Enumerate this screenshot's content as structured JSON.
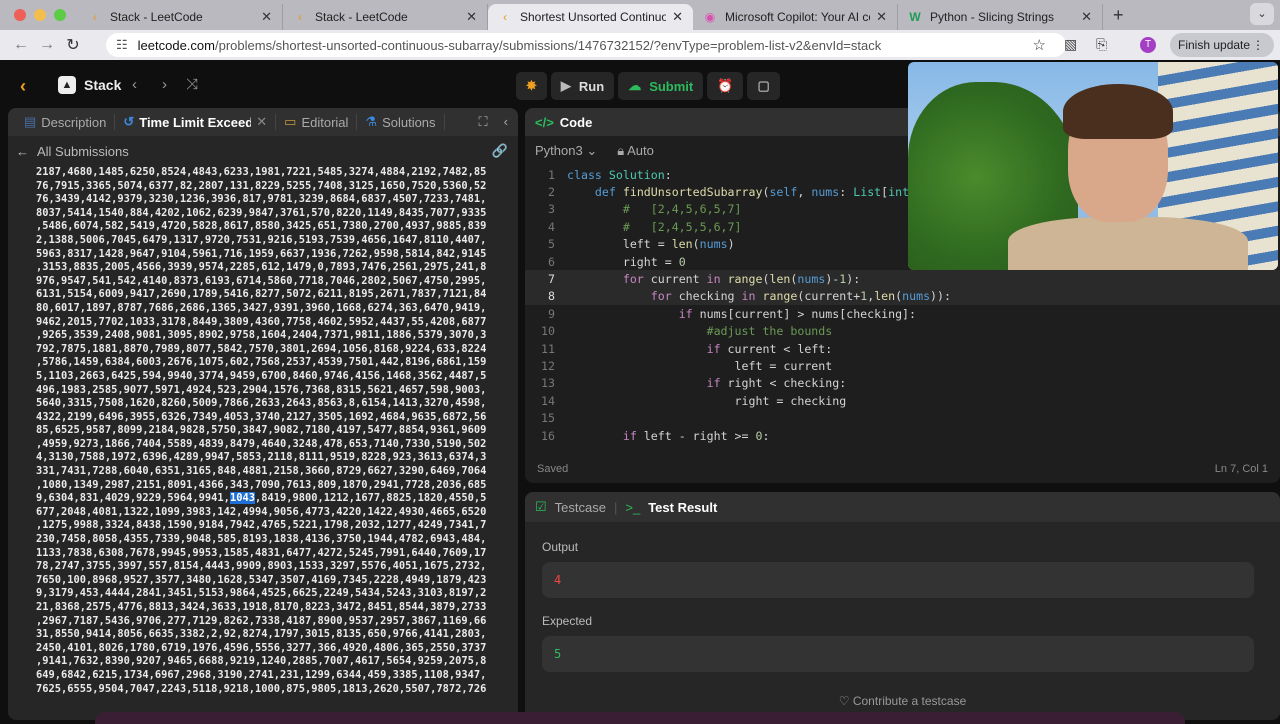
{
  "browser": {
    "tabs": [
      {
        "title": "Stack - LeetCode",
        "icon": "leetcode-icon",
        "active": false
      },
      {
        "title": "Stack - LeetCode",
        "icon": "leetcode-icon",
        "active": false
      },
      {
        "title": "Shortest Unsorted Continuous",
        "icon": "leetcode-icon",
        "active": true
      },
      {
        "title": "Microsoft Copilot: Your AI com",
        "icon": "copilot-icon",
        "active": false
      },
      {
        "title": "Python - Slicing Strings",
        "icon": "w3schools-icon",
        "active": false
      }
    ],
    "url_host": "leetcode.com",
    "url_path": "/problems/shortest-unsorted-continuous-subarray/submissions/1476732152/?envType=problem-list-v2&envId=stack",
    "profile_initial": "T",
    "finish_update": "Finish update"
  },
  "lc_nav": {
    "problem_list": "Stack",
    "run": "Run",
    "submit": "Submit"
  },
  "left_panel": {
    "tabs": [
      "Description",
      "Time Limit Exceeded",
      "Editorial",
      "Solutions"
    ],
    "back_label": "All Submissions",
    "numbers_before": "2187,4680,1485,6250,8524,4843,6233,1981,7221,5485,3274,4884,2192,7482,85\n76,7915,3365,5074,6377,82,2807,131,8229,5255,7408,3125,1650,7520,5360,52\n76,3439,4142,9379,3230,1236,3936,817,9781,3239,8684,6837,4507,7233,7481,\n8037,5414,1540,884,4202,1062,6239,9847,3761,570,8220,1149,8435,7077,9335\n,5486,6074,582,5419,4720,5828,8617,8580,3425,651,7380,2700,4937,9885,839\n2,1388,5006,7045,6479,1317,9720,7531,9216,5193,7539,4656,1647,8110,4407,\n5963,8317,1428,9647,9104,5961,716,1959,6637,1936,7262,9598,5814,842,9145\n,3153,8835,2005,4566,3939,9574,2285,612,1479,0,7893,7476,2561,2975,241,8\n976,9547,541,542,4140,8373,6193,6714,5860,7718,7046,2802,5067,4750,2995,\n6131,5154,6009,9417,2690,1789,5416,8277,5072,6211,8195,2671,7837,7121,84\n80,6017,1897,8787,7686,2686,1365,3427,9391,3960,1668,6274,363,6470,9419,\n9462,2015,7702,1033,3178,8449,3809,4360,7758,4602,5952,4437,55,4208,6877\n,9265,3539,2408,9081,3095,8902,9758,1604,2404,7371,9811,1886,5379,3070,3\n792,7875,1881,8870,7989,8077,5842,7570,3801,2694,1056,8168,9224,633,8224\n,5786,1459,6384,6003,2676,1075,602,7568,2537,4539,7501,442,8196,6861,159\n5,1103,2663,6425,594,9940,3774,9459,6700,8460,9746,4156,1468,3562,4487,5\n496,1983,2585,9077,5971,4924,523,2904,1576,7368,8315,5621,4657,598,9003,\n5640,3315,7508,1620,8260,5009,7866,2633,2643,8563,8,6154,1413,3270,4598,\n4322,2199,6496,3955,6326,7349,4053,3740,2127,3505,1692,4684,9635,6872,56\n85,6525,9587,8099,2184,9828,5750,3847,9082,7180,4197,5477,8854,9361,9609\n,4959,9273,1866,7404,5589,4839,8479,4640,3248,478,653,7140,7330,5190,502\n4,3130,7588,1972,6396,4289,9947,5853,2118,8111,9519,8228,923,3613,6374,3\n331,7431,7288,6040,6351,3165,848,4881,2158,3660,8729,6627,3290,6469,7064\n,1080,1349,2987,2151,8091,4366,343,7090,7613,809,1870,2941,7728,2036,685\n9,6304,831,4029,9229,5964,9941,",
    "numbers_selected": "1043",
    "numbers_after": ",8419,9800,1212,1677,8825,1820,4550,5\n677,2048,4081,1322,1099,3983,142,4994,9056,4773,4220,1422,4930,4665,6520\n,1275,9988,3324,8438,1590,9184,7942,4765,5221,1798,2032,1277,4249,7341,7\n230,7458,8058,4355,7339,9048,585,8193,1838,4136,3750,1944,4782,6943,484,\n1133,7838,6308,7678,9945,9953,1585,4831,6477,4272,5245,7991,6440,7609,17\n78,2747,3755,3997,557,8154,4443,9909,8903,1533,3297,5576,4051,1675,2732,\n7650,100,8968,9527,3577,3480,1628,5347,3507,4169,7345,2228,4949,1879,423\n9,3179,453,4444,2841,3451,5153,9864,4525,6625,2249,5434,5243,3103,8197,2\n21,8368,2575,4776,8813,3424,3633,1918,8170,8223,3472,8451,8544,3879,2733\n,2967,7187,5436,9706,277,7129,8262,7338,4187,8900,9537,2957,3867,1169,66\n31,8550,9414,8056,6635,3382,2,92,8274,1797,3015,8135,650,9766,4141,2803,\n2450,4101,8026,1780,6719,1976,4596,5556,3277,366,4920,4806,365,2550,3737\n,9141,7632,8390,9207,9465,6688,9219,1240,2885,7007,4617,5654,9259,2075,8\n649,6842,6215,1734,6967,2968,3190,2741,231,1299,6344,459,3385,1108,9347,\n7625,6555,9504,7047,2243,5118,9218,1000,875,9805,1813,2620,5507,7872,726"
  },
  "editor": {
    "title": "Code",
    "language": "Python3",
    "mode": "Auto",
    "status": "Saved",
    "cursor": "Ln 7, Col 1",
    "lines": [
      "class Solution:",
      "    def findUnsortedSubarray(self, nums: List[int]) -> int:",
      "        #   [2,4,5,6,5,7]",
      "        #   [2,4,5,5,6,7]",
      "        left = len(nums)",
      "        right = 0",
      "        for current in range(len(nums)-1):",
      "            for checking in range(current+1,len(nums)):",
      "                if nums[current] > nums[checking]:",
      "                    #adjust the bounds",
      "                    if current < left:",
      "                        left = current",
      "                    if right < checking:",
      "                        right = checking",
      "",
      "        if left - right >= 0:"
    ]
  },
  "test_panel": {
    "tabs": [
      "Testcase",
      "Test Result"
    ],
    "output_label": "Output",
    "output_value": "4",
    "expected_label": "Expected",
    "expected_value": "5",
    "contribute": "Contribute a testcase"
  }
}
